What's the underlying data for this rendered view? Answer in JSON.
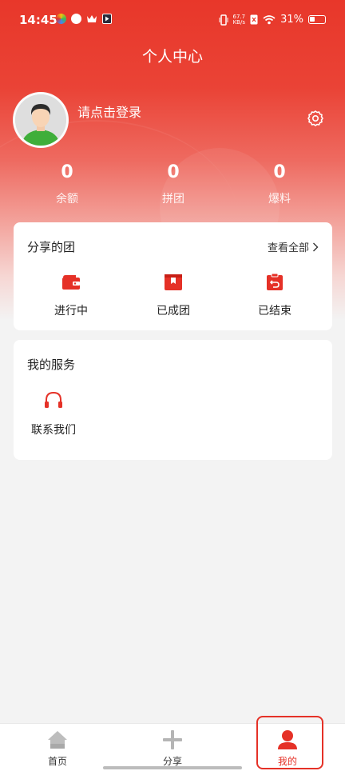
{
  "status_bar": {
    "time": "14:45",
    "network_speed_top": "67.7",
    "network_speed_unit": "KB/s",
    "battery": "31%"
  },
  "header": {
    "title": "个人中心"
  },
  "profile": {
    "login_prompt": "请点击登录"
  },
  "stats": [
    {
      "value": "0",
      "label": "余额"
    },
    {
      "value": "0",
      "label": "拼团"
    },
    {
      "value": "0",
      "label": "爆料"
    }
  ],
  "shared_groups": {
    "title": "分享的团",
    "view_all": "查看全部",
    "items": [
      {
        "label": "进行中",
        "icon": "wallet-icon"
      },
      {
        "label": "已成团",
        "icon": "box-icon"
      },
      {
        "label": "已结束",
        "icon": "return-icon"
      }
    ]
  },
  "services": {
    "title": "我的服务",
    "items": [
      {
        "label": "联系我们",
        "icon": "headset-icon"
      }
    ]
  },
  "tabbar": {
    "tabs": [
      {
        "label": "首页",
        "icon": "home-icon"
      },
      {
        "label": "分享",
        "icon": "plus-icon"
      },
      {
        "label": "我的",
        "icon": "user-icon"
      }
    ],
    "active_tab": "我的"
  },
  "colors": {
    "accent": "#e53127",
    "inactive": "#999999"
  }
}
